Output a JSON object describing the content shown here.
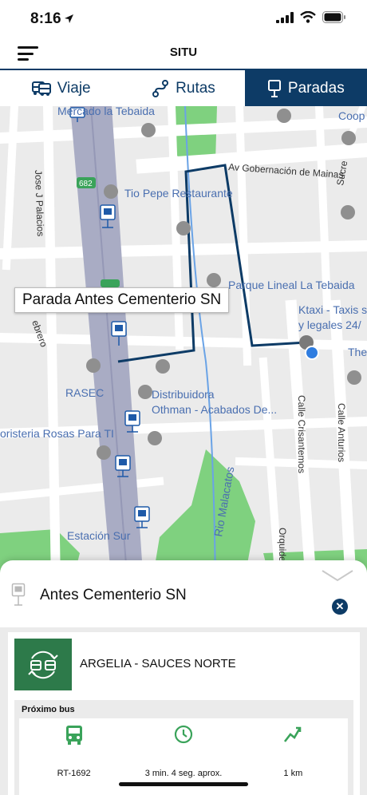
{
  "status_bar": {
    "time": "8:16"
  },
  "header": {
    "title": "SITU"
  },
  "tabs": [
    {
      "label": "Viaje",
      "icon": "bus-icon"
    },
    {
      "label": "Rutas",
      "icon": "route-icon"
    },
    {
      "label": "Paradas",
      "icon": "bus-stop-icon",
      "active": true
    }
  ],
  "map": {
    "callout": "Parada Antes Cementerio SN",
    "labels": {
      "mercado": "Mercado la Tebaida",
      "coop": "Coop",
      "av_gobernacion": "Av Gobernación de Mainas",
      "sucre": "Sucre",
      "jose_palacios": "Jose J Palacios",
      "route_682": "682",
      "tio_pepe": "Tio Pepe Restaurante",
      "parque": "Parque Lineal La Tebaida",
      "ktaxi_1": "Ktaxi - Taxis s",
      "ktaxi_2": "y legales 24/",
      "the": "The",
      "febrero": "ebrero",
      "rasec": "RASEC",
      "distribuidora_1": "Distribuidora",
      "distribuidora_2": "Othman - Acabados De...",
      "floristeria": "oristeria Rosas Para TI",
      "calle_crisantemos": "Calle Crisantemos",
      "calle_anturios": "Calle Anturios",
      "rio_malacatos": "Rio Malacatos",
      "orquide": "Orquide",
      "estacion_sur": "Estación Sur"
    },
    "route_color": "#0d3b66"
  },
  "stop_sheet": {
    "stop_name": "Antes Cementerio SN",
    "route_name": "ARGELIA - SAUCES NORTE",
    "next_bus_label": "Próximo bus",
    "bus_id": "RT-1692",
    "eta": "3 min. 4 seg. aprox.",
    "distance": "1 km"
  },
  "colors": {
    "primary": "#0d3b66",
    "green": "#2d7a4a",
    "icon_green": "#3aa35a"
  }
}
